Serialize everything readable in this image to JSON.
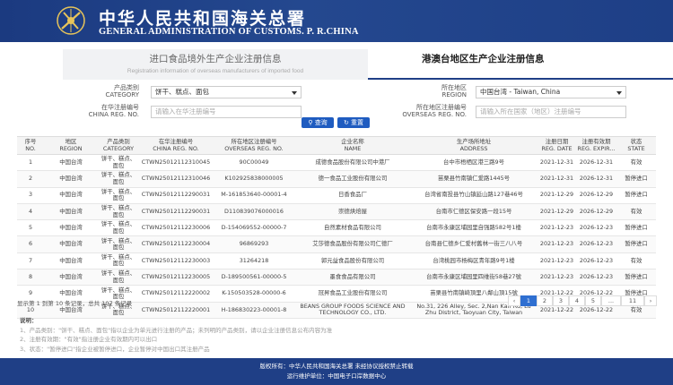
{
  "header": {
    "title_cn": "中华人民共和国海关总署",
    "title_en": "GENERAL ADMINISTRATION OF CUSTOMS. P. R.CHINA"
  },
  "tabs": {
    "tab1_cn": "进口食品境外生产企业注册信息",
    "tab1_en": "Registration information of overseas manufacturers of imported food",
    "tab2_cn": "港澳台地区生产企业注册信息"
  },
  "form": {
    "category_label_cn": "产品类别",
    "category_label_en": "CATEGORY",
    "category_value": "饼干、糕点、面包",
    "region_label_cn": "所在地区",
    "region_label_en": "REGION",
    "region_value": "中国台湾 - Taiwan, China",
    "china_reg_label_cn": "在华注册编号",
    "china_reg_label_en": "CHINA REG. NO.",
    "china_reg_placeholder": "请输入在华注册编号",
    "overseas_reg_label_cn": "所在地区注册编号",
    "overseas_reg_label_en": "OVERSEAS REG. NO.",
    "overseas_reg_placeholder": "请输入所在国家（地区）注册编号",
    "search_label": "查询",
    "reset_label": "重置"
  },
  "table": {
    "headers": [
      {
        "cn": "序号",
        "en": "NO."
      },
      {
        "cn": "地区",
        "en": "REGION"
      },
      {
        "cn": "产品类别",
        "en": "CATEGORY"
      },
      {
        "cn": "在华注册编号",
        "en": "CHINA REG. NO."
      },
      {
        "cn": "所在地区注册编号",
        "en": "OVERSEAS REG. NO."
      },
      {
        "cn": "企业名称",
        "en": "NAME"
      },
      {
        "cn": "生产场所地址",
        "en": "ADDRESS"
      },
      {
        "cn": "注册日期",
        "en": "REG. DATE"
      },
      {
        "cn": "注册有效期",
        "en": "REG. EXPIR..."
      },
      {
        "cn": "状态",
        "en": "STATE"
      }
    ],
    "rows": [
      [
        "1",
        "中国台湾",
        "饼干、糕点、面包",
        "CTWN25012112310045",
        "90C00049",
        "成德食品股份有限公司中港厂",
        "台中市梧栖区港三路9号",
        "2021-12-31",
        "2026-12-31",
        "有效"
      ],
      [
        "2",
        "中国台湾",
        "饼干、糕点、面包",
        "CTWN25012112310046",
        "K102925838000005",
        "德一食品工业股份有限公司",
        "苗栗县竹南镇仁爱路1445号",
        "2021-12-31",
        "2026-12-31",
        "暂停进口"
      ],
      [
        "3",
        "中国台湾",
        "饼干、糕点、面包",
        "CTWN25012112290031",
        "M-161853640-00001-4",
        "日香食品厂",
        "台湾省南投县竹山镇延山路127巷46号",
        "2021-12-29",
        "2026-12-29",
        "暂停进口"
      ],
      [
        "4",
        "中国台湾",
        "饼干、糕点、面包",
        "CTWN25012112290031",
        "D110839076000016",
        "崇德烘焙屋",
        "台南市仁德区保安路一段15号",
        "2021-12-29",
        "2026-12-29",
        "有效"
      ],
      [
        "5",
        "中国台湾",
        "饼干、糕点、面包",
        "CTWN25012112230006",
        "D-154069552-00000-7",
        "自然素材食品有限公司",
        "台南市永康区埔园里自强路582号1楼",
        "2021-12-23",
        "2026-12-23",
        "暂停进口"
      ],
      [
        "6",
        "中国台湾",
        "饼干、糕点、面包",
        "CTWN25012112230004",
        "96869293",
        "艾莎德食品股份有限公司仁德厂",
        "台南县仁德乡仁爱村舊林一街三八八号",
        "2021-12-23",
        "2026-12-23",
        "暂停进口"
      ],
      [
        "7",
        "中国台湾",
        "饼干、糕点、面包",
        "CTWN25012112230003",
        "31264218",
        "郭元益食品股份有限公司",
        "台湾桃园市杨梅区青年路9号1楼",
        "2021-12-23",
        "2026-12-23",
        "有效"
      ],
      [
        "8",
        "中国台湾",
        "饼干、糕点、面包",
        "CTWN25012112230005",
        "D-189500561-00000-5",
        "墨食食品有限公司",
        "台南市永康区埔园里四维街58巷27號",
        "2021-12-23",
        "2026-12-23",
        "暂停进口"
      ],
      [
        "9",
        "中国台湾",
        "饼干、糕点、面包",
        "CTWN25012112220002",
        "K-150503528-00000-6",
        "冠昇食品工业股份有限公司",
        "苗栗县竹南镇崎頂里八鄰山頂15號",
        "2021-12-22",
        "2026-12-22",
        "暂停进口"
      ],
      [
        "10",
        "中国台湾",
        "饼干、糕点、面包",
        "CTWN25012112220001",
        "H-186830223-00001-8",
        "BEANS GROUP FOODS SCIENCE AND TECHNOLOGY CO., LTD.",
        "No.31, 226 Alley, Sec. 2,Nan Kan Rd, Lu Zhu District, Taoyuan City, Taiwan",
        "2021-12-22",
        "2026-12-22",
        "有效"
      ]
    ]
  },
  "summary": "显示第 1 到第 10 条记录，总共 107 条记录",
  "pager": [
    "‹",
    "1",
    "2",
    "3",
    "4",
    "5",
    "...",
    "11",
    "›"
  ],
  "notes": {
    "title": "说明：",
    "items": [
      "1、产品类别：\"饼干、糕点、面包\"指以企业为单元进行注册的产品；未列明的产品类别，请以企业注册信息公布内容为准",
      "2、注册有效期：\"有效\"指注册企业有效期内可以出口",
      "3、状态：\"暂停进口\"指企业被暂停进口，企业暂停对中国出口其注册产品"
    ]
  },
  "footer": {
    "line1": "版权所有：中华人民共和国海关总署 未经协议授权禁止转载",
    "line2": "运行维护单位：中国电子口岸数据中心"
  },
  "colors": {
    "brand_blue": "#1f3f86",
    "button_blue": "#1f5cc0"
  }
}
